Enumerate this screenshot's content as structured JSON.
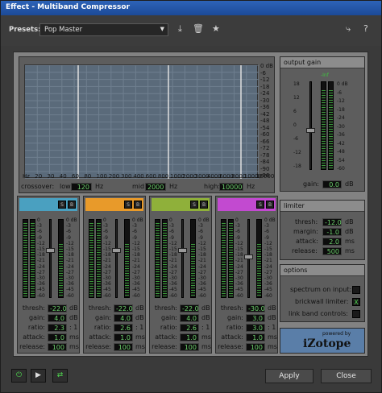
{
  "window": {
    "title": "Effect - Multiband Compressor"
  },
  "toolbar": {
    "presets_label": "Presets:",
    "preset_value": "Pop Master"
  },
  "graph": {
    "db_labels": [
      "0 dB",
      "-6",
      "-12",
      "-18",
      "-24",
      "-30",
      "-36",
      "-42",
      "-48",
      "-54",
      "-60",
      "-66",
      "-72",
      "-78",
      "-84",
      "-90",
      "-96"
    ],
    "hz_labels": [
      "Hz",
      "20",
      "30",
      "40",
      "60",
      "80",
      "100",
      "200",
      "300",
      "400",
      "600",
      "800",
      "1000",
      "2000",
      "3000",
      "4000",
      "6000",
      "8000",
      "10000",
      "16000"
    ],
    "crossover_label": "crossover:",
    "low_label": "low:",
    "low_value": "120",
    "low_unit": "Hz",
    "mid_label": "mid:",
    "mid_value": "2000",
    "mid_unit": "Hz",
    "high_label": "high:",
    "high_value": "10000",
    "high_unit": "Hz"
  },
  "band_scale": [
    "0",
    "-3",
    "-6",
    "-9",
    "-12",
    "-15",
    "-18",
    "-21",
    "-24",
    "-27",
    "-30",
    "-36",
    "-45",
    "-60"
  ],
  "band_meter_scale": [
    "0 dB",
    "-3",
    "-6",
    "-9",
    "-12",
    "-15",
    "-18",
    "-21",
    "-24",
    "-27",
    "-30",
    "-36",
    "-45",
    "-60"
  ],
  "band_params": {
    "thresh_label": "thresh:",
    "gain_label": "gain:",
    "ratio_label": "ratio:",
    "attack_label": "attack:",
    "release_label": "release:",
    "db": "dB",
    "ratio_unit": ": 1",
    "ms": "ms"
  },
  "bands": [
    {
      "color": "#4aa0c0",
      "thresh": "-22.0",
      "gain": "4.0",
      "ratio": "2.3",
      "attack": "1.0",
      "release": "100",
      "solo": "S",
      "bypass": "B"
    },
    {
      "color": "#e89a2a",
      "thresh": "-22.0",
      "gain": "4.0",
      "ratio": "2.6",
      "attack": "1.0",
      "release": "100",
      "solo": "S",
      "bypass": "B"
    },
    {
      "color": "#8fb03a",
      "thresh": "-22.0",
      "gain": "4.0",
      "ratio": "2.6",
      "attack": "1.0",
      "release": "100",
      "solo": "S",
      "bypass": "B"
    },
    {
      "color": "#c24ad0",
      "thresh": "-30.0",
      "gain": "3.0",
      "ratio": "3.0",
      "attack": "1.0",
      "release": "100",
      "solo": "S",
      "bypass": "B"
    }
  ],
  "output_gain": {
    "title": "output gain",
    "inf_label": "-Inf",
    "scale": [
      "18",
      "12",
      "6",
      "0",
      "-6",
      "-12",
      "-18"
    ],
    "meter_scale": [
      "0 dB",
      "-6",
      "-12",
      "-18",
      "-24",
      "-30",
      "-36",
      "-42",
      "-48",
      "-54",
      "-60"
    ],
    "gain_label": "gain:",
    "gain_value": "0.0",
    "unit": "dB"
  },
  "limiter": {
    "title": "limiter",
    "thresh_label": "thresh:",
    "thresh_value": "-12.0",
    "thresh_unit": "dB",
    "margin_label": "margin:",
    "margin_value": "-1.0",
    "margin_unit": "dB",
    "attack_label": "attack:",
    "attack_value": "2.0",
    "attack_unit": "ms",
    "release_label": "release:",
    "release_value": "500",
    "release_unit": "ms"
  },
  "options": {
    "title": "options",
    "spectrum_label": "spectrum on input:",
    "brickwall_label": "brickwall limiter:",
    "brickwall_mark": "X",
    "link_label": "link band controls:"
  },
  "logo": {
    "powered_by": "powered by",
    "brand": "iZotope"
  },
  "buttons": {
    "apply": "Apply",
    "close": "Close"
  }
}
